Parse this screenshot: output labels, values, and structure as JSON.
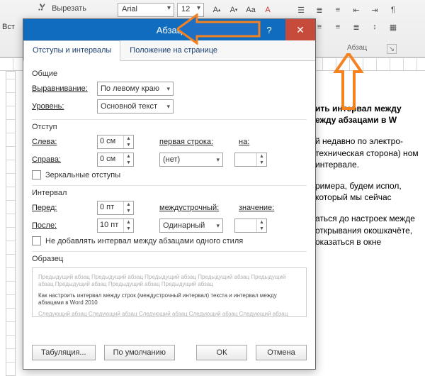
{
  "ribbon": {
    "cut_label": "Вырезать",
    "paste_hint": "Вст",
    "font_name": "Arial",
    "font_size": "12",
    "group_paragraph_label": "Абзац"
  },
  "document": {
    "line1a": "ить интервал между",
    "line1b": "ежду абзацами в W",
    "p2": "й недавно по электро­техническая сторона) ном интервале.",
    "p3": "римера, будем испол­, который мы сейчас",
    "p4": "аться до настроек меж­де открывания окошка­чёте, оказаться в окне"
  },
  "dialog": {
    "title": "Абзац",
    "tab1": "Отступы и интервалы",
    "tab2": "Положение на странице",
    "grp_general": "Общие",
    "alignment_label": "Выравнивание:",
    "alignment_value": "По левому краю",
    "level_label": "Уровень:",
    "level_value": "Основной текст",
    "grp_indent": "Отступ",
    "left_label": "Слева:",
    "left_value": "0 см",
    "right_label": "Справа:",
    "right_value": "0 см",
    "firstline_label": "первая строка:",
    "firstline_value": "(нет)",
    "by_label": "на:",
    "mirror_label": "Зеркальные отступы",
    "grp_spacing": "Интервал",
    "before_label": "Перед:",
    "before_value": "0 пт",
    "after_label": "После:",
    "after_value": "10 пт",
    "linespacing_label": "междустрочный:",
    "linespacing_value": "Одинарный",
    "value_label": "значение:",
    "nospace_label": "Не добавлять интервал между абзацами одного стиля",
    "sample_label": "Образец",
    "sample_grey": "Предыдущий абзац Предыдущий абзац Предыдущий абзац Предыдущий абзац Предыдущий абзац Предыдущий абзац Предыдущий абзац Предыдущий абзац",
    "sample_main": "Как настроить интервал между строк (междустрочный интервал) текста  и интервал между абзацами в Word 2010",
    "sample_grey2": "Следующий абзац Следующий абзац Следующий абзац Следующий абзац Следующий абзац",
    "btn_tabs": "Табуляция...",
    "btn_default": "По умолчанию",
    "btn_ok": "ОК",
    "btn_cancel": "Отмена"
  }
}
